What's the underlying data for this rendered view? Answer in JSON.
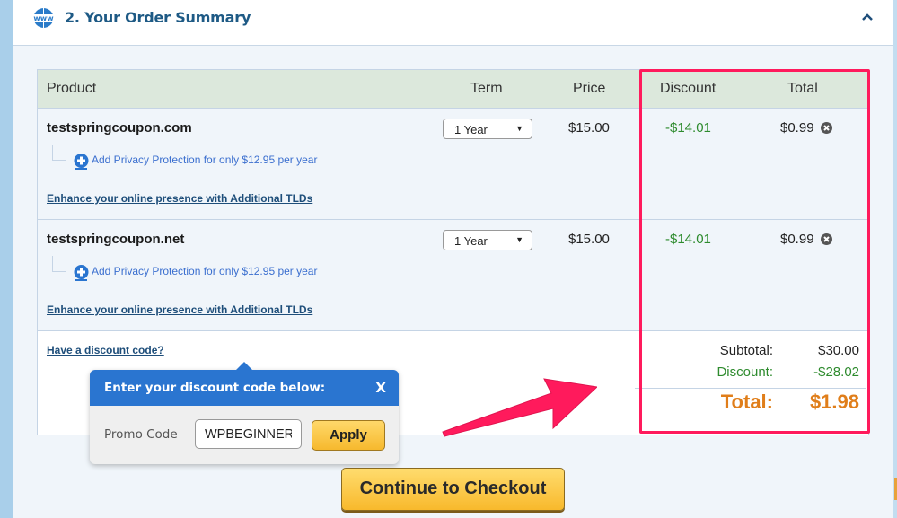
{
  "header": {
    "title": "2. Your Order Summary",
    "icon": "www-globe-icon",
    "collapse_icon": "chevron-up-icon"
  },
  "table": {
    "columns": {
      "product": "Product",
      "term": "Term",
      "price": "Price",
      "discount": "Discount",
      "total": "Total"
    },
    "rows": [
      {
        "domain": "testspringcoupon.com",
        "privacy_link": "Add Privacy Protection for only $12.95 per year",
        "tlds_link": "Enhance your online presence with Additional TLDs",
        "term": "1 Year",
        "price": "$15.00",
        "discount": "-$14.01",
        "total": "$0.99"
      },
      {
        "domain": "testspringcoupon.net",
        "privacy_link": "Add Privacy Protection for only $12.95 per year",
        "tlds_link": "Enhance your online presence with Additional TLDs",
        "term": "1 Year",
        "price": "$15.00",
        "discount": "-$14.01",
        "total": "$0.99"
      }
    ]
  },
  "summary": {
    "discount_code_link": "Have a discount code?",
    "subtotal_label": "Subtotal:",
    "subtotal_value": "$30.00",
    "discount_label": "Discount:",
    "discount_value": "-$28.02",
    "total_label": "Total:",
    "total_value": "$1.98"
  },
  "promo_popup": {
    "title": "Enter your discount code below:",
    "close_label": "X",
    "field_label": "Promo Code",
    "field_value": "WPBEGINNER",
    "apply_label": "Apply"
  },
  "checkout_button": "Continue to Checkout",
  "colors": {
    "highlight": "#ff1a5c",
    "discount_green": "#2e8b2e",
    "total_orange": "#e07e1a",
    "popup_blue": "#2a75d0",
    "button_yellow": "#f8b92c"
  }
}
